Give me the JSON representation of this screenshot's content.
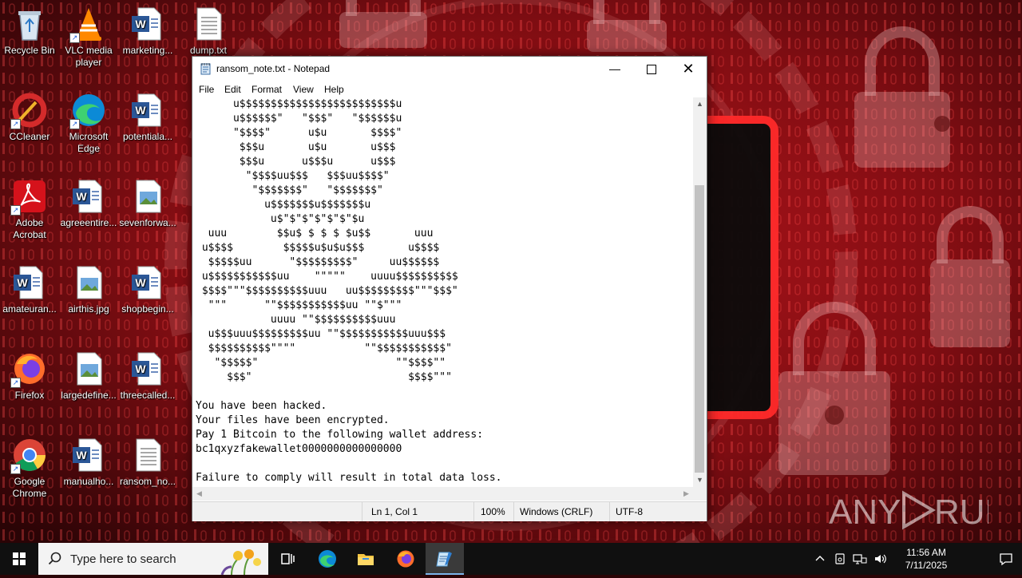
{
  "desktop": {
    "icons": [
      {
        "label": "Recycle Bin",
        "icon": "recycle-bin-icon"
      },
      {
        "label": "VLC media player",
        "icon": "vlc-icon"
      },
      {
        "label": "marketing...",
        "icon": "word-doc-icon"
      },
      {
        "label": "dump.txt",
        "icon": "text-file-icon"
      },
      {
        "label": "CCleaner",
        "icon": "ccleaner-icon"
      },
      {
        "label": "Microsoft Edge",
        "icon": "edge-icon"
      },
      {
        "label": "potentiala...",
        "icon": "word-doc-icon"
      },
      {
        "label": "Adobe Acrobat",
        "icon": "acrobat-icon"
      },
      {
        "label": "agreeentire...",
        "icon": "word-doc-icon"
      },
      {
        "label": "sevenforwa...",
        "icon": "image-file-icon"
      },
      {
        "label": "amateuran...",
        "icon": "word-doc-icon"
      },
      {
        "label": "airthis.jpg",
        "icon": "image-file-icon"
      },
      {
        "label": "shopbegin...",
        "icon": "word-doc-icon"
      },
      {
        "label": "Firefox",
        "icon": "firefox-icon"
      },
      {
        "label": "largedefine...",
        "icon": "image-file-icon"
      },
      {
        "label": "threecalled...",
        "icon": "word-doc-icon"
      },
      {
        "label": "Google Chrome",
        "icon": "chrome-icon"
      },
      {
        "label": "manualho...",
        "icon": "word-doc-icon"
      },
      {
        "label": "ransom_no...",
        "icon": "text-file-icon"
      }
    ]
  },
  "notepad": {
    "title": "ransom_note.txt - Notepad",
    "menu": [
      "File",
      "Edit",
      "Format",
      "View",
      "Help"
    ],
    "content": "      u$$$$$$$$$$$$$$$$$$$$$$$$$u\n      u$$$$$$\"   \"$$$\"   \"$$$$$$u\n      \"$$$$\"      u$u       $$$$\"\n       $$$u       u$u       u$$$\n       $$$u      u$$$u      u$$$\n        \"$$$$uu$$$   $$$uu$$$$\"\n         \"$$$$$$$\"   \"$$$$$$$\"\n           u$$$$$$$u$$$$$$$u\n            u$\"$\"$\"$\"$\"$\"$u\n  uuu        $$u$ $ $ $ $u$$       uuu\n u$$$$        $$$$$u$u$u$$$       u$$$$\n  $$$$$uu      \"$$$$$$$$$\"     uu$$$$$$\n u$$$$$$$$$$$uu    \"\"\"\"\"    uuuu$$$$$$$$$$\n $$$$\"\"\"$$$$$$$$$$uuu   uu$$$$$$$$$\"\"\"$$$\"\n  \"\"\"      \"\"$$$$$$$$$$$uu \"\"$\"\"\"\n            uuuu \"\"$$$$$$$$$$uuu\n  u$$$uuu$$$$$$$$$uu \"\"$$$$$$$$$$$uuu$$$\n  $$$$$$$$$$\"\"\"\"           \"\"$$$$$$$$$$$\"\n   \"$$$$$\"                      \"\"$$$$\"\"\n     $$$\"                         $$$$\"\"\"\n\nYou have been hacked.\nYour files have been encrypted.\nPay 1 Bitcoin to the following wallet address:\nbc1qxyzfakewallet0000000000000000\n\nFailure to comply will result in total data loss.",
    "status": {
      "position": "Ln 1, Col 1",
      "zoom": "100%",
      "line_endings": "Windows (CRLF)",
      "encoding": "UTF-8"
    }
  },
  "watermark": {
    "brand": "ANY RUN"
  },
  "taskbar": {
    "search_placeholder": "Type here to search",
    "time": "11:56 AM",
    "date": "7/11/2025"
  },
  "colors": {
    "wallpaper_red": "#c8131b",
    "taskbar_bg": "#101010",
    "notepad_accent": "#7ab4ea"
  }
}
